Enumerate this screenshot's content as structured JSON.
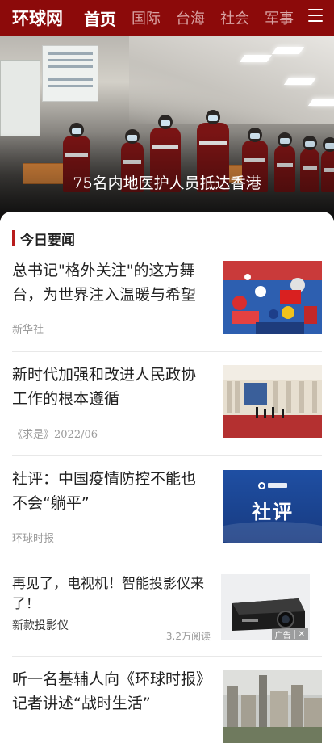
{
  "nav": {
    "logo": "环球网",
    "tabs": [
      "首页",
      "国际",
      "台海",
      "社会",
      "军事"
    ],
    "active_tab": "首页"
  },
  "hero": {
    "caption": "75名内地医护人员抵达香港"
  },
  "section": {
    "title": "今日要闻"
  },
  "articles": [
    {
      "title": "总书记\"格外关注\"的这方舞台，为世界注入温暖与希望",
      "source": "新华社"
    },
    {
      "title": "新时代加强和改进人民政协工作的根本遵循",
      "source": "《求是》2022/06"
    },
    {
      "title": "社评：中国疫情防控不能也不会“躺平”",
      "source": "环球时报",
      "thumb_text": "社评"
    },
    {
      "title": "听一名基辅人向《环球时报》记者讲述“战时生活”",
      "source": ""
    }
  ],
  "ad": {
    "title": "再见了，电视机！智能投影仪来了！",
    "subtitle": "新款投影仪",
    "reads": "3.2万阅读",
    "badge": "广告",
    "close": "✕"
  },
  "colors": {
    "brand": "#8c0a0a",
    "accent": "#b81c1c"
  }
}
